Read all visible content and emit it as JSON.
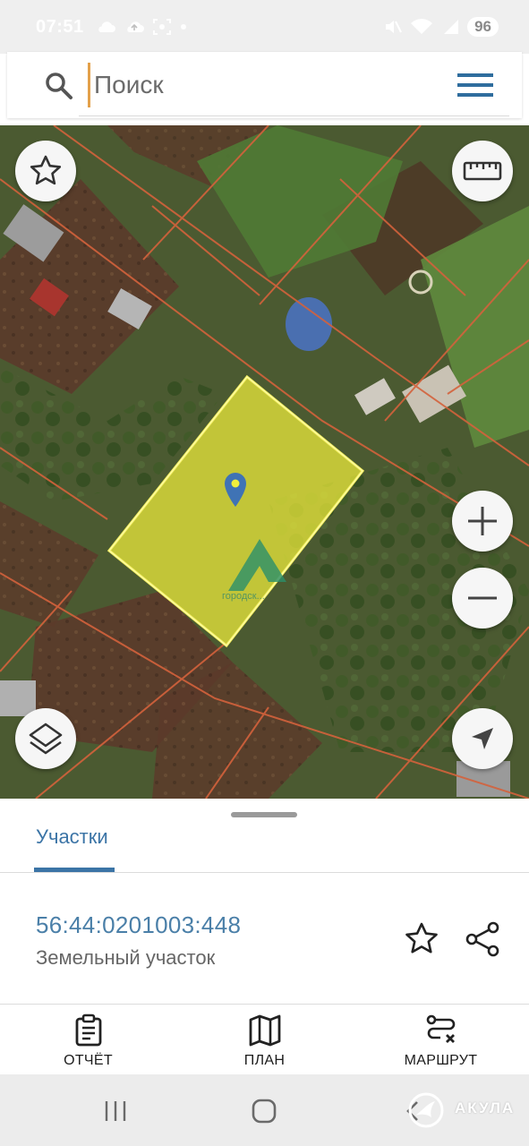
{
  "status_bar": {
    "time": "07:51",
    "battery": "96",
    "icons": [
      "cloud-icon",
      "cloud-upload-icon",
      "screenshot-icon",
      "dot-icon",
      "mute-icon",
      "wifi-icon",
      "signal-icon"
    ]
  },
  "search": {
    "placeholder": "Поиск",
    "value": "",
    "icon": "search-icon",
    "menu_icon": "hamburger-menu-icon"
  },
  "map": {
    "watermark": "городск...",
    "buttons": [
      "favorite-icon",
      "ruler-icon",
      "zoom-in-icon",
      "zoom-out-icon",
      "layers-icon",
      "navigation-arrow-icon"
    ],
    "selected_parcel_color": "#f0ee3c",
    "boundary_color": "#d4623c"
  },
  "sheet": {
    "tab_label": "Участки",
    "parcel": {
      "cadastral_number": "56:44:0201003:448",
      "type": "Земельный участок"
    },
    "actions": [
      {
        "label": "ОТЧЁТ",
        "icon": "clipboard-report-icon"
      },
      {
        "label": "ПЛАН",
        "icon": "map-plan-icon"
      },
      {
        "label": "МАРШРУТ",
        "icon": "route-icon"
      }
    ]
  },
  "nav_bar": {
    "brand": "АКУЛА"
  },
  "colors": {
    "accent": "#3b74a6",
    "link": "#4a7fa8",
    "secondary_text": "#666666"
  }
}
